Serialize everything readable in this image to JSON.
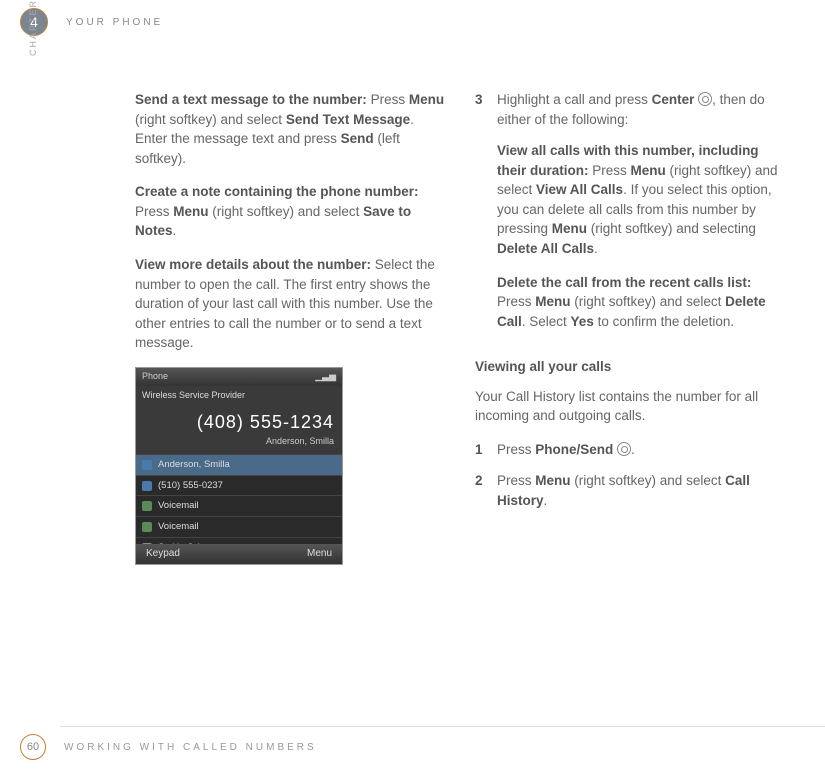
{
  "chapter": {
    "number": "4",
    "label": "CHAPTER",
    "title": "YOUR PHONE"
  },
  "left": {
    "p1": {
      "lead": "Send a text message to the number:",
      "body": " Press ",
      "b1": "Menu",
      "body2": " (right softkey) and select ",
      "b2": "Send Text Message",
      "body3": ". Enter the message text and press ",
      "b3": "Send",
      "body4": " (left softkey)."
    },
    "p2": {
      "lead": "Create a note containing the phone number:",
      "body": " Press ",
      "b1": "Menu",
      "body2": " (right softkey) and select ",
      "b2": "Save to Notes",
      "body3": "."
    },
    "p3": {
      "lead": "View more details about the number:",
      "body": " Select the number to open the call. The first entry shows the duration of your last call with this number. Use the other entries to call the number or to send a text message."
    }
  },
  "phone": {
    "topLeft": "Phone",
    "provider": "Wireless Service Provider",
    "bigNumber": "(408) 555-1234",
    "bigName": "Anderson, Smilla",
    "rows": [
      {
        "text": "Anderson, Smilla",
        "sel": true,
        "ico": "in"
      },
      {
        "text": "(510) 555-0237",
        "sel": false,
        "ico": "in"
      },
      {
        "text": "Voicemail",
        "sel": false,
        "ico": "vm"
      },
      {
        "text": "Voicemail",
        "sel": false,
        "ico": "vm"
      },
      {
        "text": "Smith, John",
        "sel": false,
        "ico": "out"
      }
    ],
    "leftSoft": "Keypad",
    "rightSoft": "Menu"
  },
  "right": {
    "s3": {
      "num": "3",
      "a": "Highlight a call and press ",
      "b1": "Center",
      "a2": ", then do either of the following:"
    },
    "s3p2": {
      "lead": "View all calls with this number, including their duration:",
      "a": " Press ",
      "b1": "Menu",
      "a2": " (right softkey) and select ",
      "b2": "View All Calls",
      "a3": ". If you select this option, you can delete all calls from this number by pressing ",
      "b3": "Menu",
      "a4": " (right softkey) and selecting ",
      "b4": "Delete All Calls",
      "a5": "."
    },
    "s3p3": {
      "lead": "Delete the call from the recent calls list:",
      "a": " Press ",
      "b1": "Menu",
      "a2": " (right softkey) and select ",
      "b2": "Delete Call",
      "a3": ". Select ",
      "b3": "Yes",
      "a4": " to confirm the deletion."
    },
    "h3": "Viewing all your calls",
    "p4": "Your Call History list contains the number for all incoming and outgoing calls.",
    "s1": {
      "num": "1",
      "a": "Press ",
      "b1": "Phone/Send",
      "a2": "."
    },
    "s2": {
      "num": "2",
      "a": "Press ",
      "b1": "Menu",
      "a2": " (right softkey) and select ",
      "b2": "Call History",
      "a3": "."
    }
  },
  "footer": {
    "page": "60",
    "title": "WORKING WITH CALLED NUMBERS"
  }
}
